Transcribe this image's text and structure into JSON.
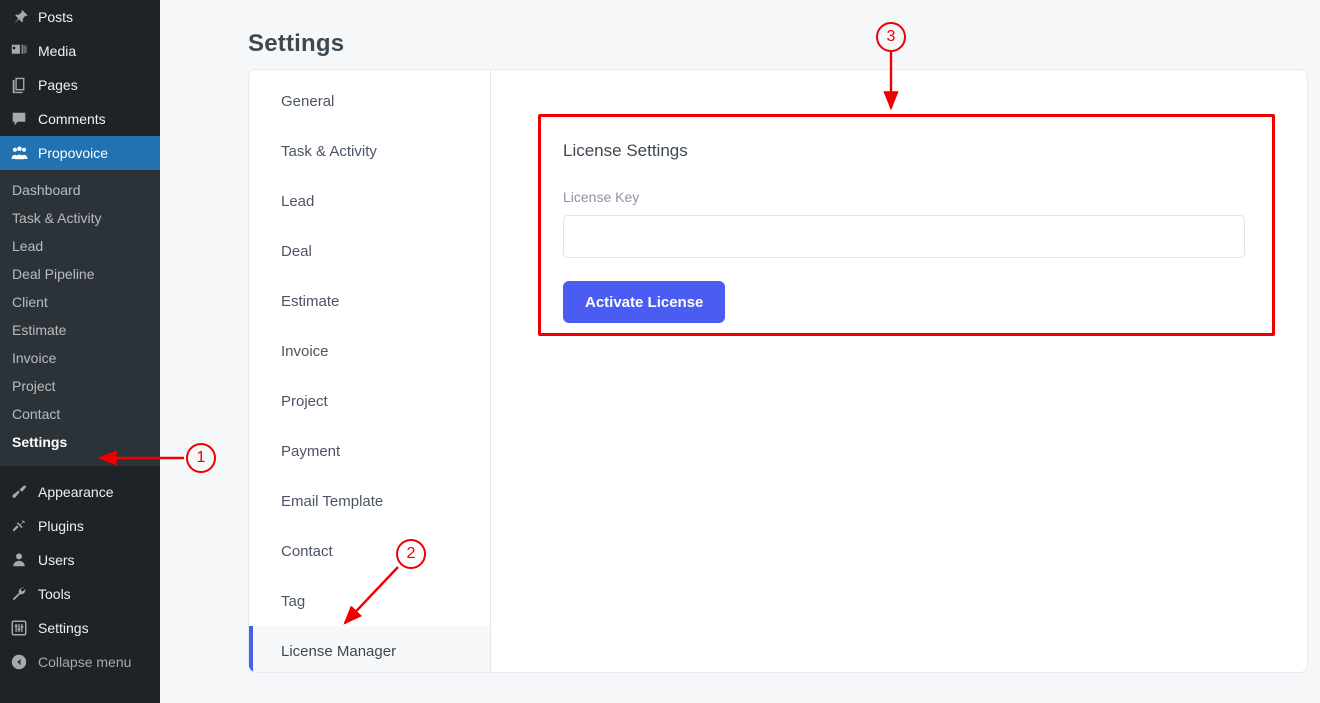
{
  "wp_admin_menu": {
    "top_items": [
      {
        "label": "Posts",
        "icon": "pushpin-icon"
      },
      {
        "label": "Media",
        "icon": "media-icon"
      },
      {
        "label": "Pages",
        "icon": "pages-icon"
      },
      {
        "label": "Comments",
        "icon": "comment-bubble-icon"
      }
    ],
    "active_item": {
      "label": "Propovoice",
      "icon": "group-people-icon"
    },
    "submenu": [
      {
        "label": "Dashboard",
        "current": false
      },
      {
        "label": "Task & Activity",
        "current": false
      },
      {
        "label": "Lead",
        "current": false
      },
      {
        "label": "Deal Pipeline",
        "current": false
      },
      {
        "label": "Client",
        "current": false
      },
      {
        "label": "Estimate",
        "current": false
      },
      {
        "label": "Invoice",
        "current": false
      },
      {
        "label": "Project",
        "current": false
      },
      {
        "label": "Contact",
        "current": false
      },
      {
        "label": "Settings",
        "current": true
      }
    ],
    "bottom_items": [
      {
        "label": "Appearance",
        "icon": "paintbrush-icon"
      },
      {
        "label": "Plugins",
        "icon": "plug-icon"
      },
      {
        "label": "Users",
        "icon": "user-icon"
      },
      {
        "label": "Tools",
        "icon": "wrench-icon"
      },
      {
        "label": "Settings",
        "icon": "sliders-icon"
      }
    ],
    "collapse": {
      "label": "Collapse menu",
      "icon": "collapse-arrow-icon"
    }
  },
  "page": {
    "title": "Settings"
  },
  "settings_tabs": [
    {
      "label": "General",
      "active": false
    },
    {
      "label": "Task & Activity",
      "active": false
    },
    {
      "label": "Lead",
      "active": false
    },
    {
      "label": "Deal",
      "active": false
    },
    {
      "label": "Estimate",
      "active": false
    },
    {
      "label": "Invoice",
      "active": false
    },
    {
      "label": "Project",
      "active": false
    },
    {
      "label": "Payment",
      "active": false
    },
    {
      "label": "Email Template",
      "active": false
    },
    {
      "label": "Contact",
      "active": false
    },
    {
      "label": "Tag",
      "active": false
    },
    {
      "label": "License Manager",
      "active": true
    }
  ],
  "license_panel": {
    "title": "License Settings",
    "field_label": "License Key",
    "license_key_value": "",
    "license_key_placeholder": "",
    "activate_button": "Activate License"
  },
  "annotations": {
    "markers": [
      {
        "id": "1",
        "label": "1",
        "target": "sidebar-settings"
      },
      {
        "id": "2",
        "label": "2",
        "target": "tab-license-manager"
      },
      {
        "id": "3",
        "label": "3",
        "target": "license-settings-panel"
      }
    ],
    "highlight_color": "#ee0000"
  },
  "colors": {
    "accent_blue": "#4a5cf2",
    "tab_active_border": "#4361ee",
    "wp_menu_bg": "#1d2327",
    "wp_submenu_bg": "#2c3338",
    "wp_active_bg": "#2271b1",
    "annotation_red": "#ee0000",
    "page_bg": "#f6f7f9"
  }
}
